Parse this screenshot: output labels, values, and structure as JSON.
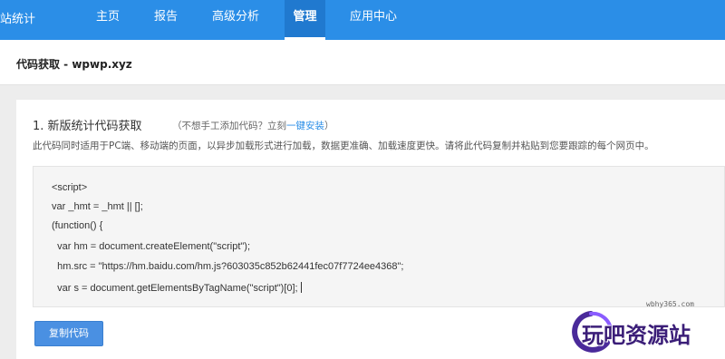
{
  "header": {
    "logo_text": "站统计",
    "nav": [
      {
        "label": "主页",
        "active": false
      },
      {
        "label": "报告",
        "active": false
      },
      {
        "label": "高级分析",
        "active": false
      },
      {
        "label": "管理",
        "active": true
      },
      {
        "label": "应用中心",
        "active": false
      }
    ]
  },
  "page": {
    "title": "代码获取 - wpwp.xyz"
  },
  "section": {
    "step_title": "1. 新版统计代码获取",
    "note_prefix": "（不想手工添加代码？立刻",
    "note_link": "一键安装",
    "note_suffix": "）",
    "description": "此代码同时适用于PC端、移动端的页面，以异步加载形式进行加载，数据更准确、加载速度更快。请将此代码复制并粘贴到您要跟踪的每个网页中。"
  },
  "code": {
    "lines": [
      "<script>",
      "var _hmt = _hmt || [];",
      "(function() {",
      "  var hm = document.createElement(\"script\");",
      "  hm.src = \"https://hm.baidu.com/hm.js?603035c852b62441fec07f7724ee4368\";",
      "  var s = document.getElementsByTagName(\"script\")[0];"
    ]
  },
  "actions": {
    "copy_label": "复制代码"
  },
  "watermark": {
    "url": "wbhy365.com",
    "text": "玩吧资源站"
  },
  "colors": {
    "nav_bg": "#2b8ee7",
    "nav_active": "#2079cf",
    "button_bg": "#4a90e2",
    "link": "#2b8ee7"
  }
}
